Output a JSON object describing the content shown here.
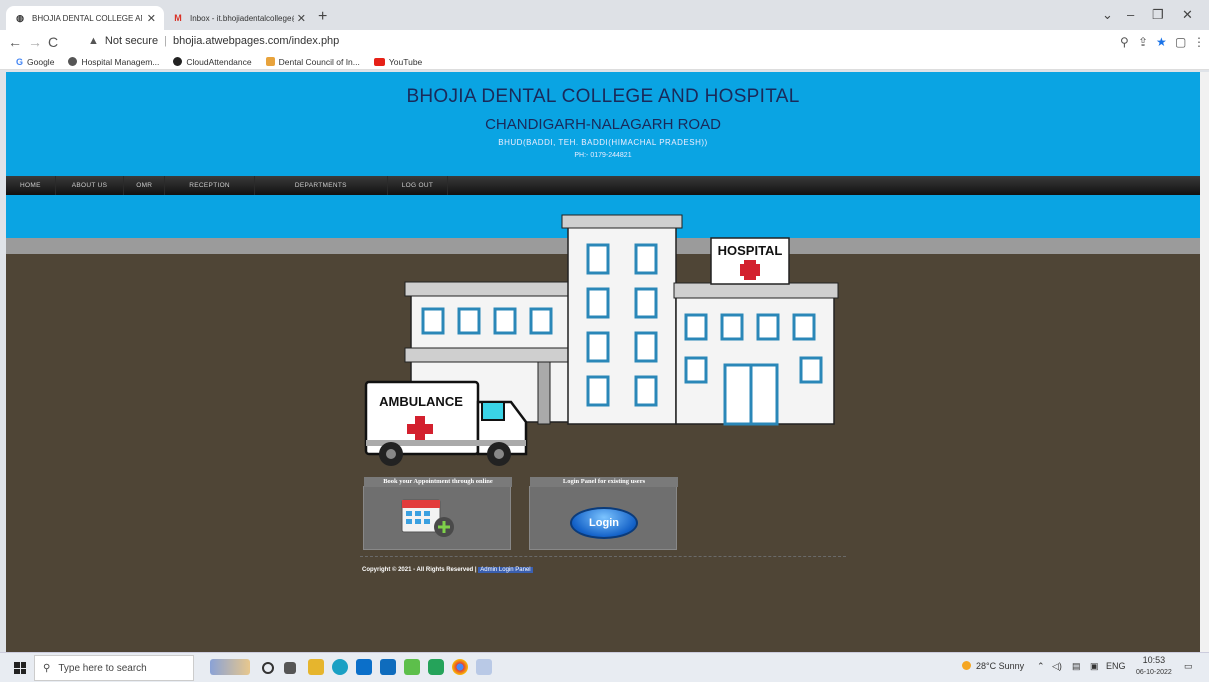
{
  "browser": {
    "tabs": [
      {
        "title": "BHOJIA DENTAL COLLEGE AND HOSPITAL",
        "active": true
      },
      {
        "title": "Inbox - it.bhojiadentalcollege@g",
        "active": false
      }
    ],
    "security_label": "Not secure",
    "url": "bhojia.atwebpages.com/index.php",
    "bookmarks": [
      "Google",
      "Hospital Managem...",
      "CloudAttendance",
      "Dental Council of In...",
      "YouTube"
    ]
  },
  "header": {
    "title": "BHOJIA DENTAL COLLEGE AND HOSPITAL",
    "subtitle": "CHANDIGARH-NALAGARH ROAD",
    "address": "BHUD(BADDI, TEH. BADDI(HIMACHAL PRADESH))",
    "phone": "PH:- 0179-244821"
  },
  "menu": [
    "HOME",
    "ABOUT US",
    "OMR",
    "RECEPTION",
    "DEPARTMENTS",
    "LOG OUT"
  ],
  "scene": {
    "ambulance_label": "AMBULANCE",
    "hospital_label": "HOSPITAL"
  },
  "cards": {
    "appointment_title": "Book your Appointment through online",
    "login_title": "Login Panel for existing users",
    "login_button": "Login"
  },
  "footer": {
    "copyright": "Copyright © 2021 - All Rights Reserved |",
    "admin_link": "Admin Login Panel"
  },
  "taskbar": {
    "search_placeholder": "Type here to search",
    "weather": "28°C Sunny",
    "lang": "ENG",
    "time": "10:53",
    "date": "06-10-2022"
  },
  "colors": {
    "header_bg": "#0aa4e3",
    "page_bg": "#4f4536",
    "menu_bg": "#1a1a1a"
  }
}
